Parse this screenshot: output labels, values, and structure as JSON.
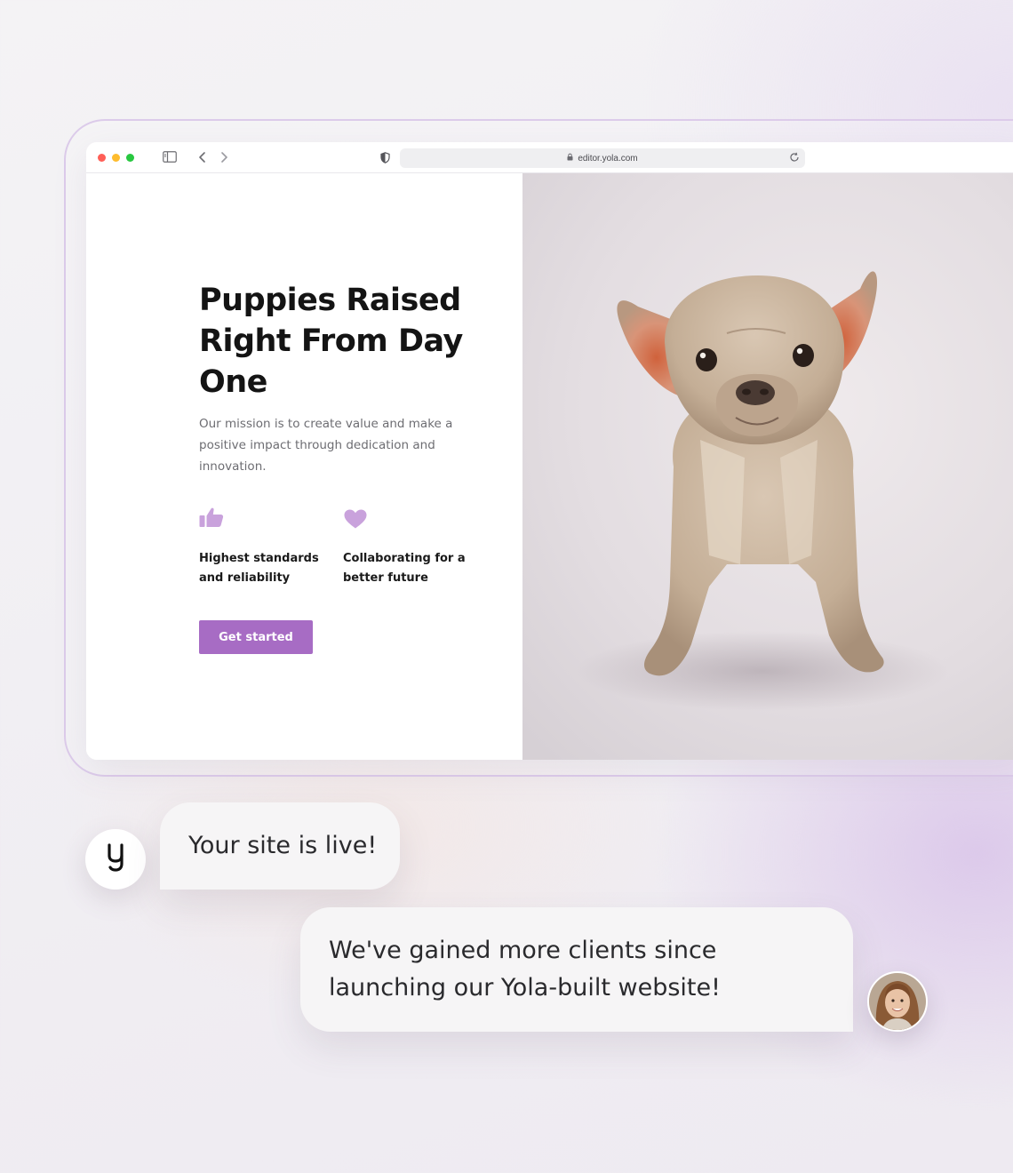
{
  "browser": {
    "url": "editor.yola.com"
  },
  "hero": {
    "title": "Puppies Raised Right From Day One",
    "description": "Our mission is to create value and make a positive impact through dedication and innovation.",
    "features": [
      {
        "icon": "thumbs-up-icon",
        "text": "Highest standards and reliability"
      },
      {
        "icon": "heart-icon",
        "text": "Collaborating for a better future"
      }
    ],
    "cta_label": "Get started",
    "accent_color": "#a76cc4",
    "icon_color": "#c9a2dc"
  },
  "chat": {
    "bot_logo": "y",
    "bot_message": "Your site is live!",
    "user_message": "We've gained more clients since launching our Yola-built website!"
  }
}
